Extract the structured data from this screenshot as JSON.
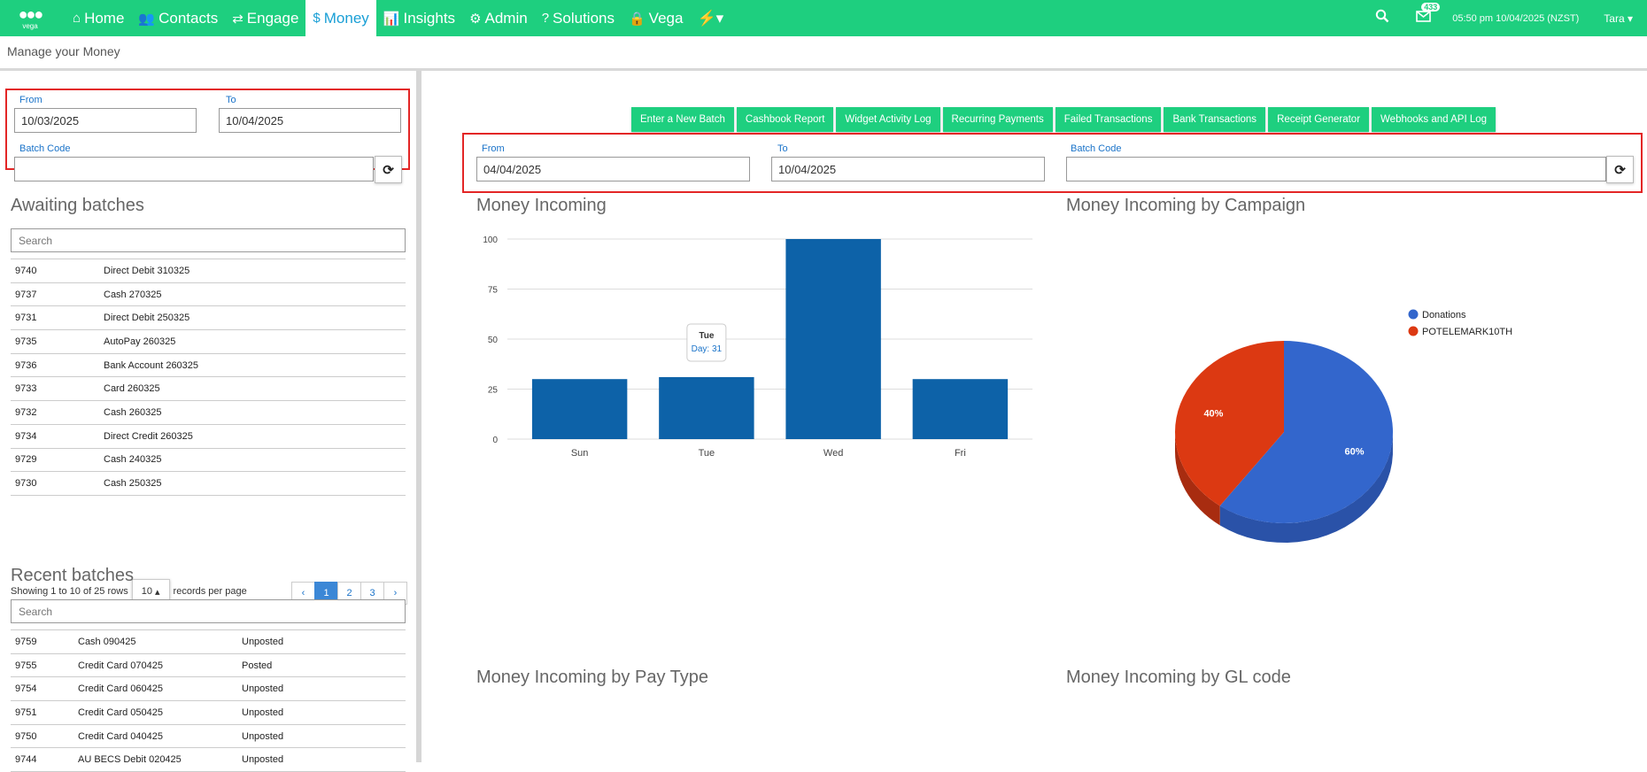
{
  "nav": {
    "logo_text": "vega",
    "items": [
      {
        "label": "Home",
        "icon": "home-icon",
        "glyph": "⌂"
      },
      {
        "label": "Contacts",
        "icon": "users-icon",
        "glyph": "👥"
      },
      {
        "label": "Engage",
        "icon": "exchange-icon",
        "glyph": "⇄"
      },
      {
        "label": "Money",
        "icon": "dollar-icon",
        "glyph": "$"
      },
      {
        "label": "Insights",
        "icon": "bar-chart-icon",
        "glyph": "📊"
      },
      {
        "label": "Admin",
        "icon": "cogs-icon",
        "glyph": "⚙"
      },
      {
        "label": "Solutions",
        "icon": "question-circle-icon",
        "glyph": "?"
      },
      {
        "label": "Vega",
        "icon": "lock-icon",
        "glyph": "🔒"
      }
    ],
    "bolt_glyph": "⚡▾",
    "mail_badge": "433",
    "datetime": "05:50 pm 10/04/2025 (NZST)",
    "user": "Tara ▾"
  },
  "page_subtitle": "Manage your Money",
  "left_filter": {
    "from_label": "From",
    "from_value": "10/03/2025",
    "to_label": "To",
    "to_value": "10/04/2025",
    "batch_code_label": "Batch Code",
    "batch_code_value": ""
  },
  "awaiting": {
    "title": "Awaiting batches",
    "search_placeholder": "Search",
    "rows": [
      {
        "code": "9740",
        "name": "Direct Debit 310325"
      },
      {
        "code": "9737",
        "name": "Cash 270325"
      },
      {
        "code": "9731",
        "name": "Direct Debit 250325"
      },
      {
        "code": "9735",
        "name": "AutoPay 260325"
      },
      {
        "code": "9736",
        "name": "Bank Account 260325"
      },
      {
        "code": "9733",
        "name": "Card 260325"
      },
      {
        "code": "9732",
        "name": "Cash 260325"
      },
      {
        "code": "9734",
        "name": "Direct Credit 260325"
      },
      {
        "code": "9729",
        "name": "Cash 240325"
      },
      {
        "code": "9730",
        "name": "Cash 250325"
      }
    ],
    "showing_text": "Showing 1 to 10 of 25 rows",
    "rpp_value": "10",
    "rpp_suffix": "records per page",
    "pages": [
      "‹",
      "1",
      "2",
      "3",
      "›"
    ]
  },
  "recent": {
    "title": "Recent batches",
    "search_placeholder": "Search",
    "rows": [
      {
        "code": "9759",
        "name": "Cash 090425",
        "status": "Unposted"
      },
      {
        "code": "9755",
        "name": "Credit Card 070425",
        "status": "Posted"
      },
      {
        "code": "9754",
        "name": "Credit Card 060425",
        "status": "Unposted"
      },
      {
        "code": "9751",
        "name": "Credit Card 050425",
        "status": "Unposted"
      },
      {
        "code": "9750",
        "name": "Credit Card 040425",
        "status": "Unposted"
      },
      {
        "code": "9744",
        "name": "AU BECS Debit 020425",
        "status": "Unposted"
      }
    ]
  },
  "tabs": [
    "Enter a New Batch",
    "Cashbook Report",
    "Widget Activity Log",
    "Recurring Payments",
    "Failed Transactions",
    "Bank Transactions",
    "Receipt Generator",
    "Webhooks and API Log"
  ],
  "right_filter": {
    "from_label": "From",
    "from_value": "04/04/2025",
    "to_label": "To",
    "to_value": "10/04/2025",
    "batch_code_label": "Batch Code",
    "batch_code_value": ""
  },
  "charts": {
    "incoming_title": "Money Incoming",
    "campaign_title": "Money Incoming by Campaign",
    "paytype_title": "Money Incoming by Pay Type",
    "glcode_title": "Money Incoming by GL code"
  },
  "chart_data": [
    {
      "type": "bar",
      "title": "Money Incoming",
      "categories": [
        "Sun",
        "Tue",
        "Wed",
        "Fri"
      ],
      "values": [
        30,
        31,
        100,
        30
      ],
      "ylim": [
        0,
        100
      ],
      "yticks": [
        0,
        25,
        50,
        75,
        100
      ],
      "color": "#0d62a8",
      "grid": true,
      "tooltip": {
        "title": "Tue",
        "text": "Day: 31"
      }
    },
    {
      "type": "pie",
      "title": "Money Incoming by Campaign",
      "labels": [
        "Donations",
        "POTELEMARK10TH"
      ],
      "values": [
        60,
        40
      ],
      "value_labels": [
        "60%",
        "40%"
      ],
      "colors": [
        "#3366cc",
        "#dc3912"
      ],
      "legend": "top-right"
    }
  ]
}
